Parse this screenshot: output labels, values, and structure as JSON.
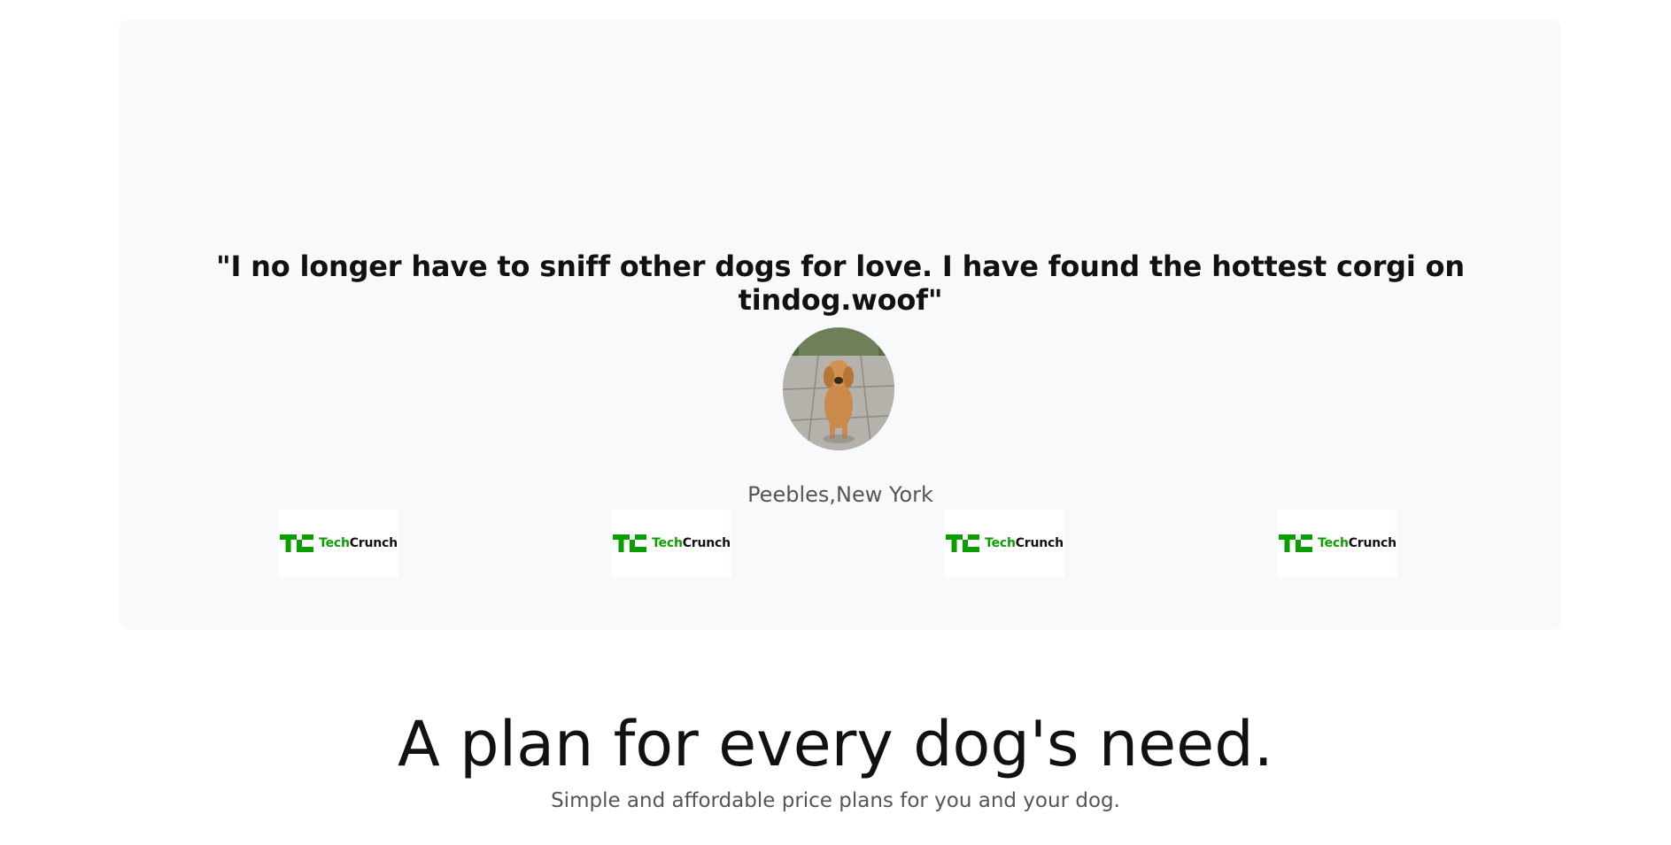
{
  "testimonial": {
    "quote": "\"I no longer have to sniff other dogs for love. I have found the hottest corgi on tindog.woof\"",
    "author": "Peebles,New York"
  },
  "press": {
    "logos": [
      {
        "tech": "Tech",
        "crunch": "Crunch",
        "icon": "techcrunch-logo-icon"
      },
      {
        "tech": "Tech",
        "crunch": "Crunch",
        "icon": "techcrunch-logo-icon"
      },
      {
        "tech": "Tech",
        "crunch": "Crunch",
        "icon": "techcrunch-logo-icon"
      },
      {
        "tech": "Tech",
        "crunch": "Crunch",
        "icon": "techcrunch-logo-icon"
      }
    ]
  },
  "pricing": {
    "title": "A plan for every dog's need.",
    "subtitle": "Simple and affordable price plans for you and your dog."
  },
  "colors": {
    "section_bg": "#f8f9fa",
    "techcrunch_green": "#0a9e01",
    "muted_text": "#555555"
  }
}
